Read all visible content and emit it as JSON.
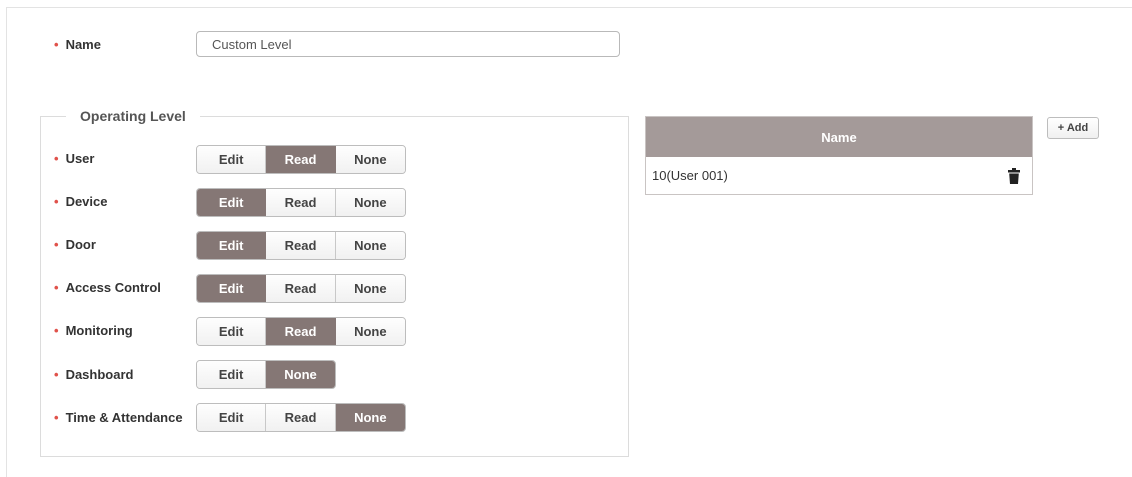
{
  "name_field": {
    "bullet": "•",
    "label": "Name",
    "value": "Custom Level"
  },
  "operating_level": {
    "legend": "Operating Level",
    "rows": [
      {
        "bullet": "•",
        "label": "User",
        "options": [
          "Edit",
          "Read",
          "None"
        ],
        "selected": "Read"
      },
      {
        "bullet": "•",
        "label": "Device",
        "options": [
          "Edit",
          "Read",
          "None"
        ],
        "selected": "Edit"
      },
      {
        "bullet": "•",
        "label": "Door",
        "options": [
          "Edit",
          "Read",
          "None"
        ],
        "selected": "Edit"
      },
      {
        "bullet": "•",
        "label": "Access Control",
        "options": [
          "Edit",
          "Read",
          "None"
        ],
        "selected": "Edit"
      },
      {
        "bullet": "•",
        "label": "Monitoring",
        "options": [
          "Edit",
          "Read",
          "None"
        ],
        "selected": "Read"
      },
      {
        "bullet": "•",
        "label": "Dashboard",
        "options": [
          "Edit",
          "None"
        ],
        "selected": "None"
      },
      {
        "bullet": "•",
        "label": "Time & Attendance",
        "options": [
          "Edit",
          "Read",
          "None"
        ],
        "selected": "None"
      }
    ]
  },
  "user_table": {
    "header": "Name",
    "rows": [
      {
        "name": "10(User 001)",
        "action_icon": "trash-icon"
      }
    ]
  },
  "add_button": {
    "label": "+ Add"
  },
  "colors": {
    "accent": "#857775",
    "table_header": "#a49a99",
    "required_dot": "#e0524b"
  }
}
